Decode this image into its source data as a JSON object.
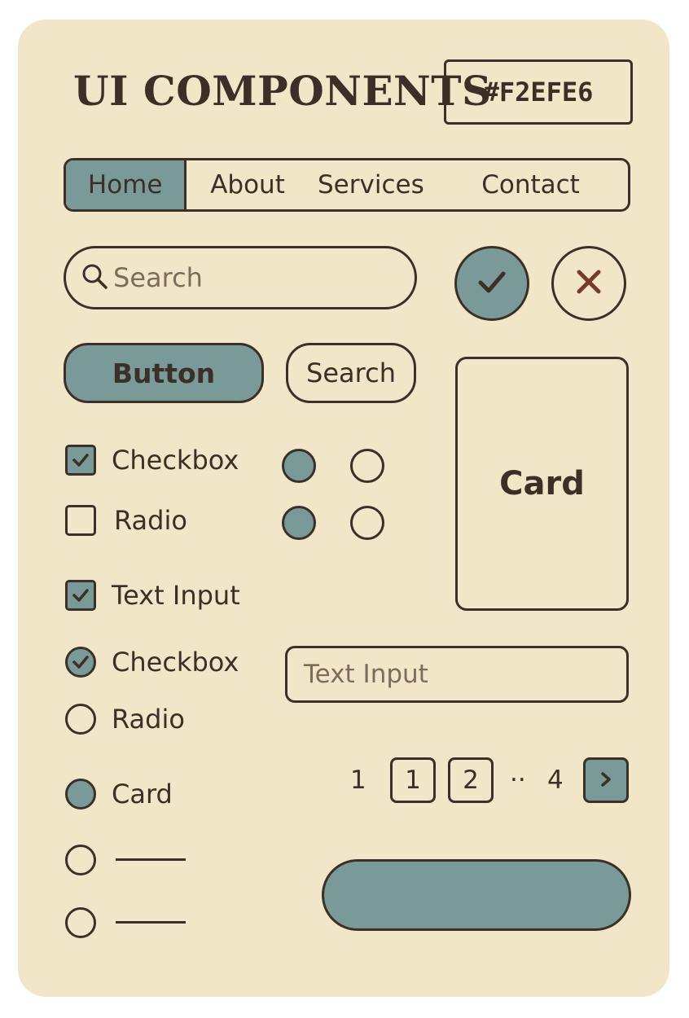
{
  "header": {
    "title": "UI COMPONENTS",
    "color_code": "#F2EFE6"
  },
  "nav": {
    "items": [
      "Home",
      "About",
      "Services",
      "Contact"
    ],
    "active_index": 0
  },
  "search": {
    "placeholder": "Search",
    "icon": "search-icon"
  },
  "actions": {
    "confirm_icon": "check-icon",
    "cancel_icon": "close-icon"
  },
  "buttons": {
    "primary_label": "Button",
    "secondary_label": "Search"
  },
  "card": {
    "label": "Card"
  },
  "checkbox_list": [
    {
      "label": "Checkbox",
      "checked": true
    },
    {
      "label": "Radio",
      "checked": false
    },
    {
      "label": "Text Input",
      "checked": true
    }
  ],
  "radio_list": [
    {
      "label": "Checkbox",
      "selected": true,
      "style": "check"
    },
    {
      "label": "Radio",
      "selected": false
    },
    {
      "label": "Card",
      "selected": true
    }
  ],
  "radio_grid": [
    [
      true,
      false
    ],
    [
      true,
      false
    ]
  ],
  "text_input": {
    "placeholder": "Text Input"
  },
  "pagination": {
    "items": [
      "1",
      "1",
      "2",
      "··",
      "4"
    ],
    "next_icon": "chevron-right-icon"
  },
  "colors": {
    "background": "#F2E6C8",
    "accent": "#7A9A9A",
    "ink": "#3B2F27",
    "danger": "#7A3A2A"
  }
}
